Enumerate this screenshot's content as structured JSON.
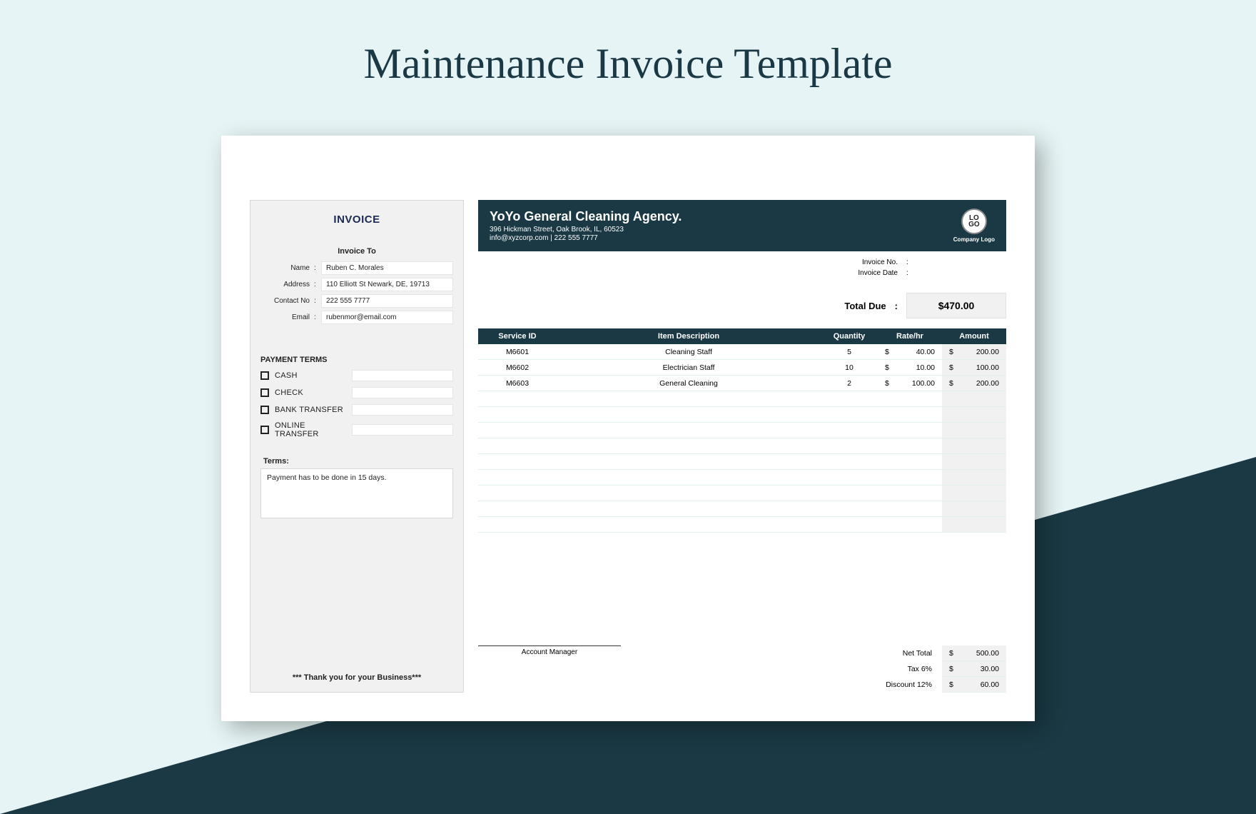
{
  "page_title": "Maintenance Invoice Template",
  "left": {
    "title": "INVOICE",
    "invoice_to_label": "Invoice To",
    "name_label": "Name",
    "name_value": "Ruben C. Morales",
    "address_label": "Address",
    "address_value": "110 Elliott St Newark, DE, 19713",
    "contact_label": "Contact No",
    "contact_value": "222 555 7777",
    "email_label": "Email",
    "email_value": "rubenmor@email.com",
    "payment_terms_label": "PAYMENT TERMS",
    "pay_options": [
      "CASH",
      "CHECK",
      "BANK TRANSFER",
      "ONLINE TRANSFER"
    ],
    "terms_label": "Terms:",
    "terms_text": "Payment has to be done in 15 days.",
    "thankyou": "*** Thank you for your Business***"
  },
  "header": {
    "company_name": "YoYo General Cleaning Agency.",
    "company_addr": "396 Hickman Street, Oak Brook, IL, 60523",
    "company_contact": "info@xyzcorp.com | 222 555 7777",
    "logo_line1": "LO",
    "logo_line2": "GO",
    "logo_label": "Company Logo"
  },
  "meta": {
    "invoice_no_label": "Invoice No.",
    "invoice_date_label": "Invoice Date",
    "total_due_label": "Total Due",
    "total_due_value": "$470.00"
  },
  "columns": {
    "id": "Service  ID",
    "desc": "Item Description",
    "qty": "Quantity",
    "rate": "Rate/hr",
    "amt": "Amount"
  },
  "items": [
    {
      "id": "M6601",
      "desc": "Cleaning Staff",
      "qty": "5",
      "rate": "40.00",
      "amt": "200.00"
    },
    {
      "id": "M6602",
      "desc": "Electrician Staff",
      "qty": "10",
      "rate": "10.00",
      "amt": "100.00"
    },
    {
      "id": "M6603",
      "desc": "General Cleaning",
      "qty": "2",
      "rate": "100.00",
      "amt": "200.00"
    }
  ],
  "currency": "$",
  "empty_rows": 9,
  "footer": {
    "sig_label": "Account Manager",
    "net_label": "Net Total",
    "net_value": "500.00",
    "tax_label": "Tax  6%",
    "tax_value": "30.00",
    "discount_label": "Discount  12%",
    "discount_value": "60.00"
  }
}
